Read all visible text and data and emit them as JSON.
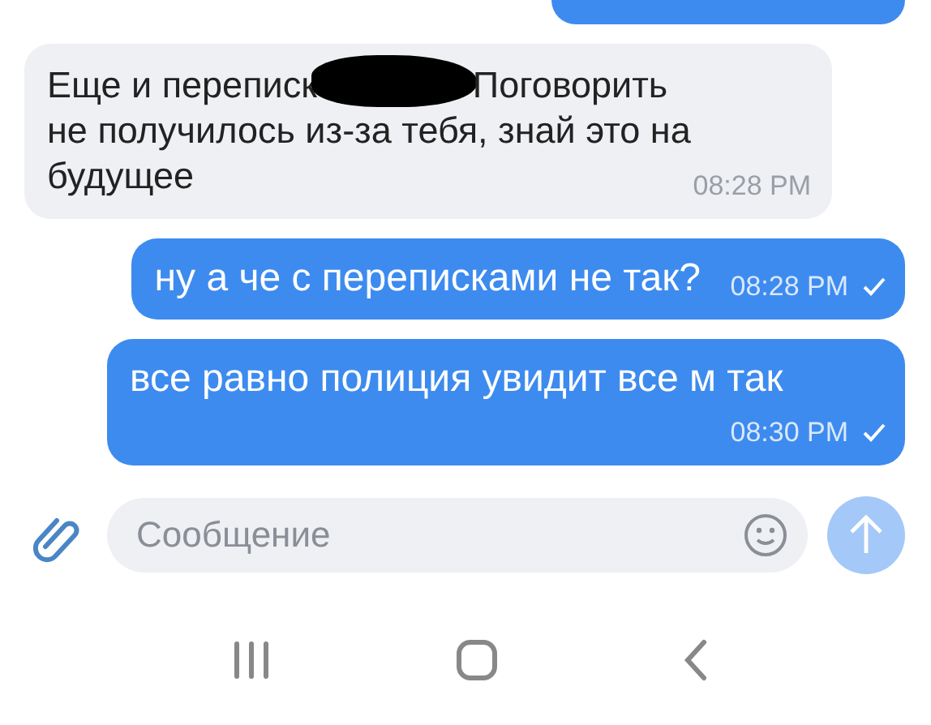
{
  "messages": [
    {
      "kind": "outgoing",
      "cut_off": true
    },
    {
      "kind": "incoming",
      "text_parts": [
        "Еще и переписк",
        "Поговорить не получилось из-за тебя, знай это на будущее"
      ],
      "redacted": true,
      "time": "08:28 PM"
    },
    {
      "kind": "outgoing",
      "text_parts": [
        "ну а че с переписками не так?"
      ],
      "time": "08:28 PM",
      "delivered": true
    },
    {
      "kind": "outgoing",
      "text_parts": [
        "все равно полиция увидит все м так"
      ],
      "time": "08:30 PM",
      "delivered": true
    }
  ],
  "composer": {
    "placeholder": "Сообщение",
    "send_enabled": false
  },
  "nav_bar": {
    "buttons": [
      {
        "kind": "recents"
      },
      {
        "kind": "home"
      },
      {
        "kind": "back"
      }
    ]
  }
}
